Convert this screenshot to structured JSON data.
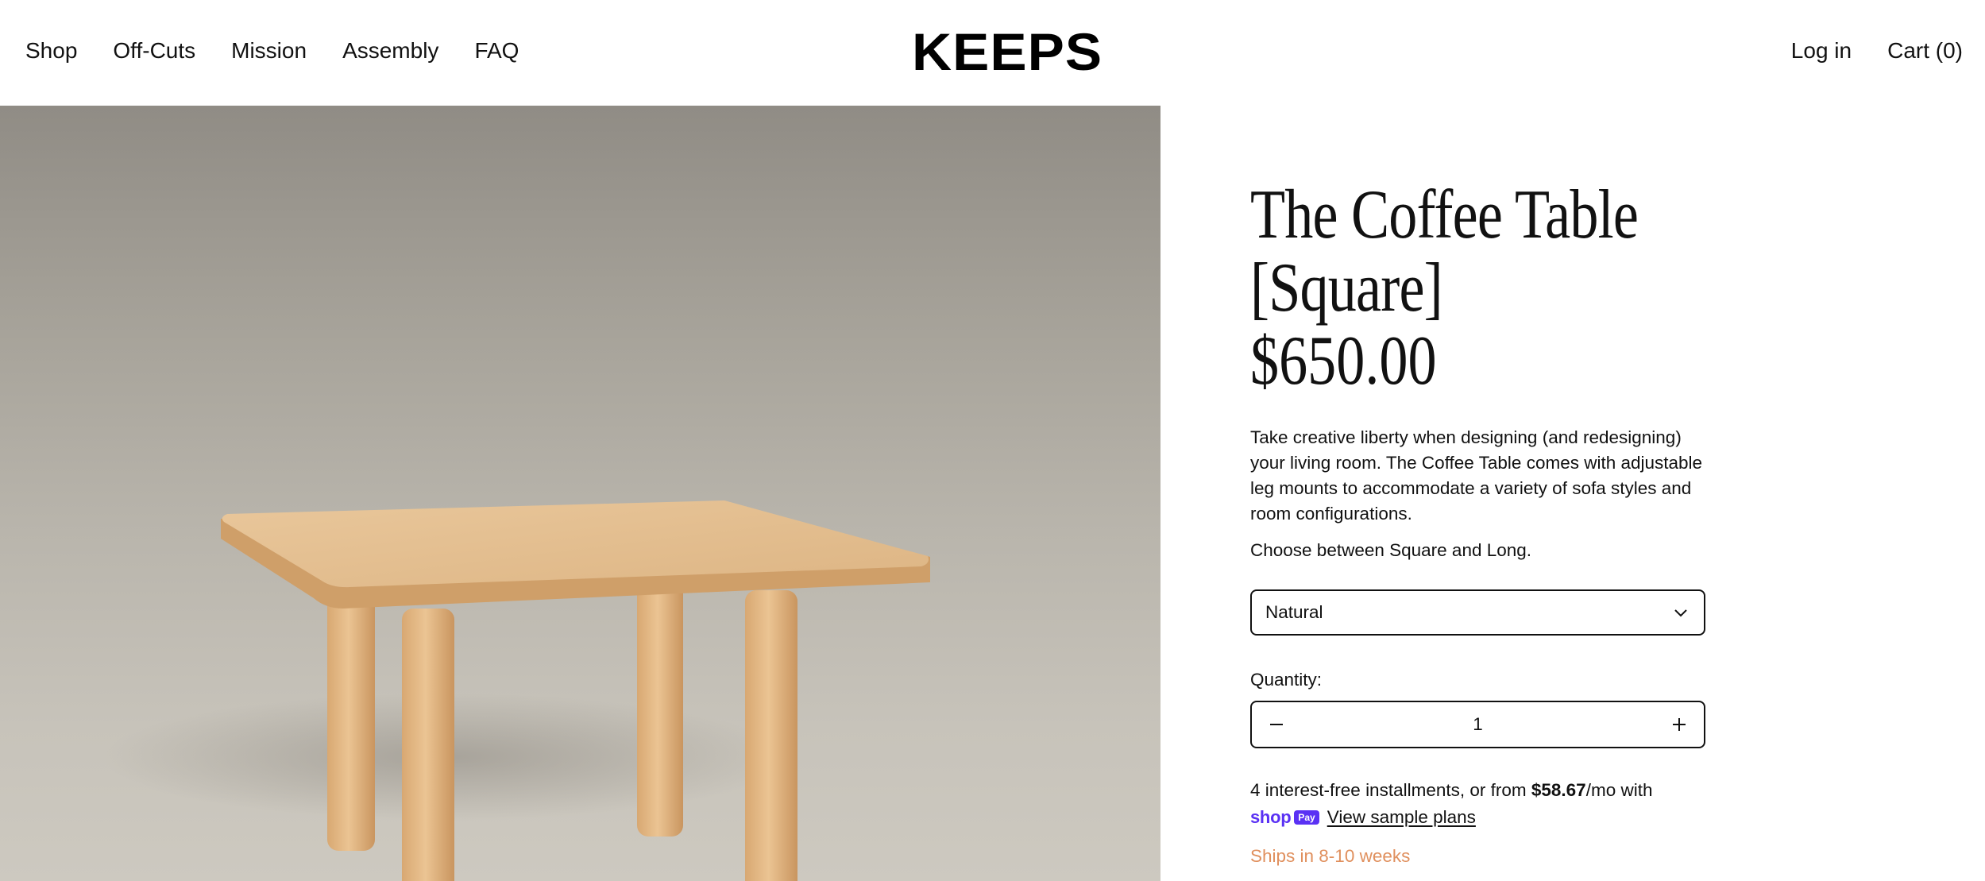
{
  "header": {
    "logo": "KEEPS",
    "nav_left": [
      "Shop",
      "Off-Cuts",
      "Mission",
      "Assembly",
      "FAQ"
    ],
    "login": "Log in",
    "cart": "Cart (0)"
  },
  "product": {
    "title_line1": "The Coffee Table",
    "title_line2": "[Square]",
    "price": "$650.00",
    "description": "Take creative liberty when designing (and redesigning) your living room. The Coffee Table comes with adjustable leg mounts to accommodate a variety of sofa styles and room configurations.",
    "choose_text": "Choose between Square and Long.",
    "finish_selected": "Natural",
    "quantity_label": "Quantity:",
    "quantity_value": "1",
    "installments_prefix": "4 interest-free installments, or from ",
    "installments_amount": "$58.67",
    "installments_suffix": "/mo with",
    "shoppay_shop": "shop",
    "shoppay_pay": "Pay",
    "view_plans": "View sample plans",
    "ships": "Ships in 8-10 weeks"
  },
  "colors": {
    "ships": "#e0905e",
    "shoppay": "#5a31f4",
    "wood": "#e4bd8c"
  }
}
